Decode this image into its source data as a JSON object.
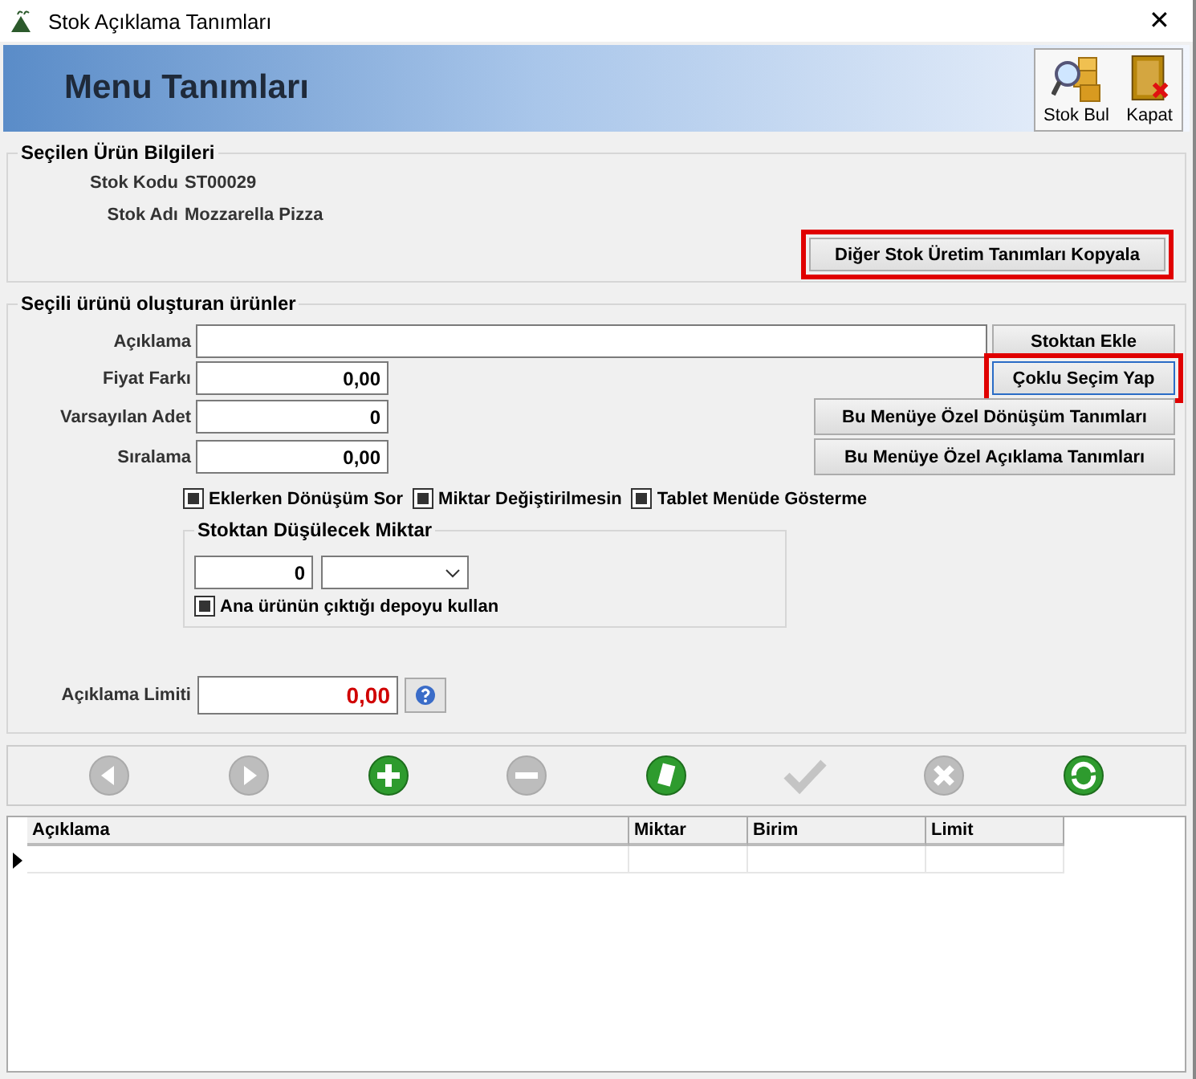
{
  "window": {
    "title": "Stok Açıklama Tanımları",
    "close": "✕"
  },
  "header": {
    "title": "Menu Tanımları",
    "tools": [
      {
        "kind": "find",
        "label": "Stok Bul"
      },
      {
        "kind": "exit",
        "label": "Kapat"
      }
    ]
  },
  "product_info": {
    "legend": "Seçilen Ürün Bilgileri",
    "fields": [
      {
        "label": "Stok Kodu",
        "value": "ST00029"
      },
      {
        "label": "Stok Adı",
        "value": "Mozzarella Pizza"
      }
    ],
    "copy_button": {
      "label": "Diğer Stok Üretim Tanımları Kopyala",
      "highlighted": true
    }
  },
  "components": {
    "legend": "Seçili ürünü oluşturan ürünler",
    "description": {
      "label": "Açıklama"
    },
    "fields": [
      {
        "label": "Fiyat Farkı",
        "value": "0,00"
      },
      {
        "label": "Varsayılan Adet",
        "value": "0"
      },
      {
        "label": "Sıralama",
        "value": "0,00"
      }
    ],
    "buttons": [
      {
        "label": "Stoktan Ekle",
        "highlighted": false,
        "focused": false,
        "wide": false
      },
      {
        "label": "Çoklu Seçim Yap",
        "highlighted": true,
        "focused": true,
        "wide": false
      },
      {
        "label": "Bu Menüye Özel Dönüşüm Tanımları",
        "highlighted": false,
        "focused": false,
        "wide": true
      },
      {
        "label": "Bu Menüye Özel Açıklama Tanımları",
        "highlighted": false,
        "focused": false,
        "wide": true
      }
    ],
    "checkboxes": [
      {
        "label": "Eklerken Dönüşüm Sor",
        "checked": true
      },
      {
        "label": "Miktar Değiştirilmesin",
        "checked": true
      },
      {
        "label": "Tablet Menüde Gösterme",
        "checked": true
      }
    ],
    "stock_group": {
      "legend": "Stoktan Düşülecek Miktar",
      "amount": "0",
      "checkbox": {
        "label": "Ana ürünün çıktığı depoyu kullan",
        "checked": true
      }
    },
    "limit": {
      "label": "Açıklama Limiti",
      "value": "0,00"
    }
  },
  "toolbar": [
    {
      "kind": "back",
      "disabled": true
    },
    {
      "kind": "forward",
      "disabled": true
    },
    {
      "kind": "add",
      "disabled": false
    },
    {
      "kind": "remove",
      "disabled": true
    },
    {
      "kind": "edit",
      "disabled": false
    },
    {
      "kind": "save",
      "disabled": true
    },
    {
      "kind": "cancel",
      "disabled": true
    },
    {
      "kind": "refresh",
      "disabled": false
    }
  ],
  "table": {
    "columns": [
      "Açıklama",
      "Miktar",
      "Birim",
      "Limit"
    ]
  }
}
